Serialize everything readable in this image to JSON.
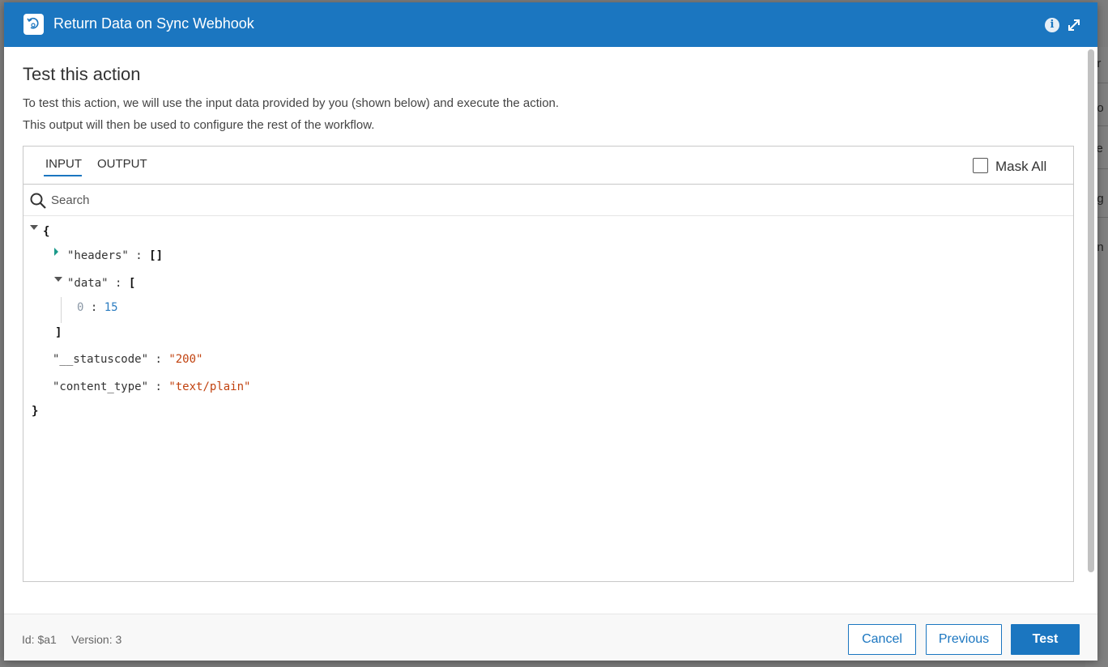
{
  "background": {
    "snippets": [
      "er",
      "no",
      "ve",
      "og",
      "dn"
    ]
  },
  "modal": {
    "title": "Return Data on Sync Webhook",
    "header_icons": [
      "workflow-icon",
      "info-icon",
      "expand-icon"
    ],
    "info_glyph": "i",
    "section_title": "Test this action",
    "description_line1": "To test this action, we will use the input data provided by you (shown below) and execute the action.",
    "description_line2": "This output will then be used to configure the rest of the workflow.",
    "tabs": [
      {
        "label": "INPUT",
        "active": true
      },
      {
        "label": "OUTPUT",
        "active": false
      }
    ],
    "mask_all": {
      "label": "Mask All",
      "checked": false
    },
    "search": {
      "placeholder": "Search",
      "value": ""
    },
    "json_tree": {
      "open_brace": "{",
      "close_brace": "}",
      "headers_key": "\"headers\"",
      "headers_value": "[]",
      "data_key": "\"data\"",
      "data_open": "[",
      "data_close": "]",
      "data_item_index": "0",
      "data_item_value": "15",
      "statuscode_key": "\"__statuscode\"",
      "statuscode_value": "\"200\"",
      "content_type_key": "\"content_type\"",
      "content_type_value": "\"text/plain\"",
      "colon": ":"
    },
    "footer": {
      "id_text": "Id: $a1",
      "version_text": "Version: 3",
      "cancel_label": "Cancel",
      "previous_label": "Previous",
      "test_label": "Test"
    }
  },
  "colors": {
    "brand": "#1b76c0",
    "string_value": "#c1420f",
    "number_value": "#2b7cc0"
  }
}
